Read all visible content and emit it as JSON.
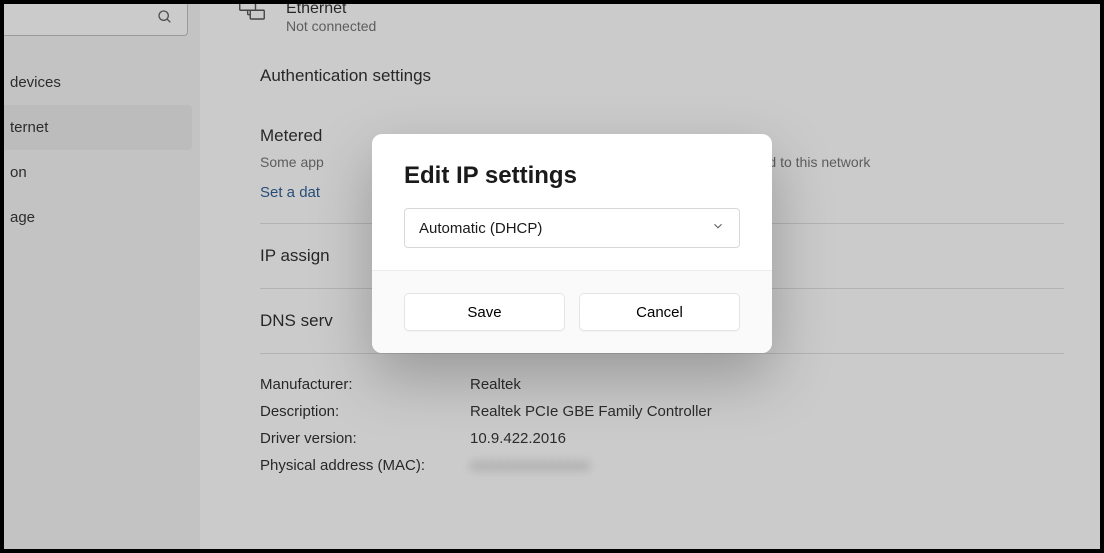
{
  "sidebar": {
    "items": [
      {
        "label": "devices"
      },
      {
        "label": "ternet"
      },
      {
        "label": "on"
      },
      {
        "label": "age"
      }
    ]
  },
  "main": {
    "ethernet": {
      "title": "Ethernet",
      "status": "Not connected"
    },
    "auth_title": "Authentication settings",
    "metered_title": "Metered",
    "metered_sub_left": "Some app",
    "metered_sub_right": "connected to this network",
    "set_link": "Set a dat",
    "ip_assign_label": "IP assign",
    "dns_label": "DNS serv",
    "info": {
      "manufacturer_label": "Manufacturer:",
      "manufacturer_value": "Realtek",
      "description_label": "Description:",
      "description_value": "Realtek PCIe GBE Family Controller",
      "driver_label": "Driver version:",
      "driver_value": "10.9.422.2016",
      "mac_label": "Physical address (MAC):",
      "mac_value": "xxxxxxxxxxxxxxxx"
    }
  },
  "dialog": {
    "title": "Edit IP settings",
    "select_value": "Automatic (DHCP)",
    "save_label": "Save",
    "cancel_label": "Cancel"
  }
}
